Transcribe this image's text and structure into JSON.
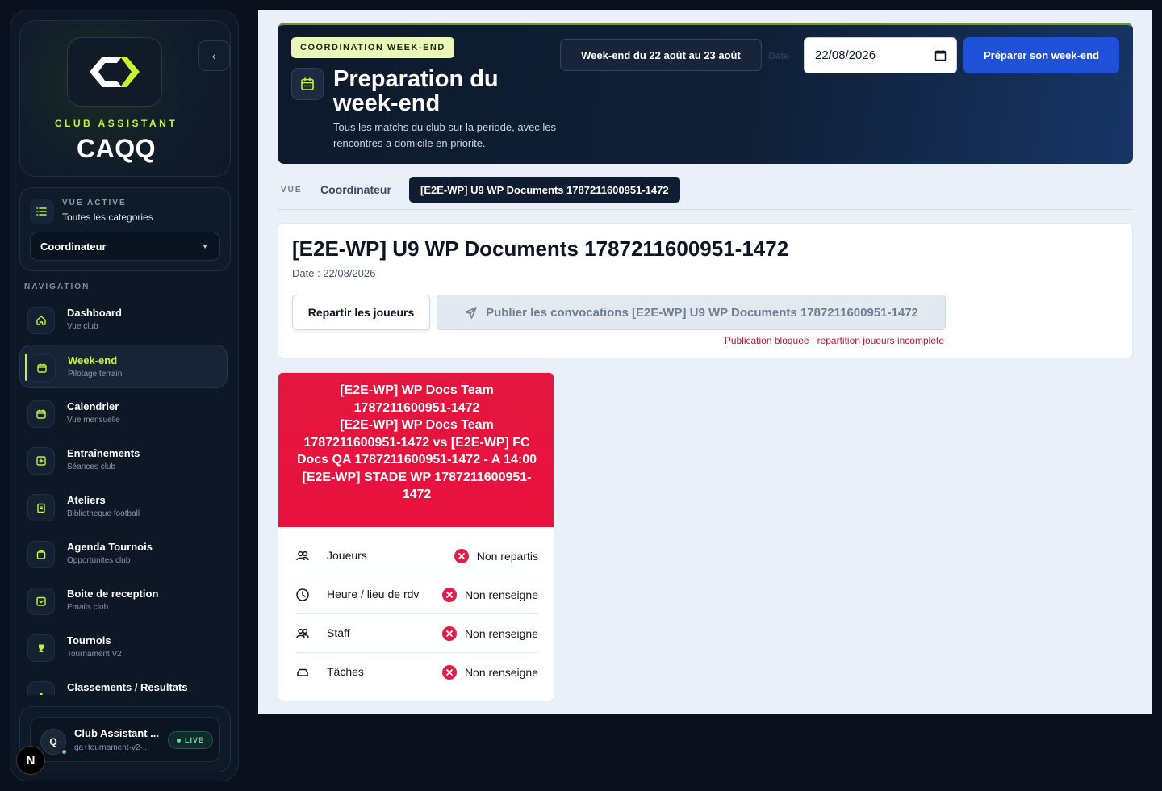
{
  "sidebar": {
    "brand_tag": "CLUB ASSISTANT",
    "brand_name": "CAQQ",
    "collapse_label": "‹",
    "view": {
      "kicker": "VUE ACTIVE",
      "value": "Toutes les categories",
      "selected": "Coordinateur"
    },
    "nav_title": "NAVIGATION",
    "items": [
      {
        "label": "Dashboard",
        "sub": "Vue club",
        "icon": "home-icon"
      },
      {
        "label": "Week-end",
        "sub": "Pilotage terrain",
        "icon": "calendar-icon"
      },
      {
        "label": "Calendrier",
        "sub": "Vue mensuelle",
        "icon": "calendar-icon"
      },
      {
        "label": "Entraînements",
        "sub": "Séances club",
        "icon": "plus-square-icon"
      },
      {
        "label": "Ateliers",
        "sub": "Bibliotheque football",
        "icon": "clipboard-icon"
      },
      {
        "label": "Agenda Tournois",
        "sub": "Opportunites club",
        "icon": "briefcase-icon"
      },
      {
        "label": "Boite de reception",
        "sub": "Emails club",
        "icon": "inbox-icon"
      },
      {
        "label": "Tournois",
        "sub": "Tournament V2",
        "icon": "trophy-icon"
      },
      {
        "label": "Classements / Resultats",
        "sub": "",
        "icon": "podium-icon"
      }
    ],
    "user": {
      "initial": "Q",
      "name": "Club Assistant ...",
      "email": "qa+tournament-v2-...",
      "badge": "LIVE"
    },
    "next_badge": "N"
  },
  "hero": {
    "kicker": "COORDINATION WEEK-END",
    "title": "Preparation du week-end",
    "description": "Tous les matchs du club sur la periode, avec les rencontres a domicile en priorite.",
    "weekend_range": "Week-end du 22 août au 23 août",
    "date_label": "Date",
    "date_value": "22/08/2026",
    "prepare_button": "Préparer son week-end"
  },
  "tabs": {
    "kicker": "VUE",
    "coordinator": "Coordinateur",
    "active": "[E2E-WP] U9 WP Documents 1787211600951-1472"
  },
  "team": {
    "title": "[E2E-WP] U9 WP Documents 1787211600951-1472",
    "date": "Date : 22/08/2026",
    "repartir_button": "Repartir les joueurs",
    "publish_button": "Publier les convocations [E2E-WP] U9 WP Documents 1787211600951-1472",
    "warning": "Publication bloquee : repartition joueurs incomplete"
  },
  "match": {
    "header_lines": [
      "[E2E-WP] WP Docs Team 1787211600951-1472",
      "[E2E-WP] WP Docs Team 1787211600951-1472 vs [E2E-WP] FC Docs QA 1787211600951-1472 - A 14:00",
      "[E2E-WP] STADE WP 1787211600951-1472"
    ],
    "rows": [
      {
        "label": "Joueurs",
        "status": "Non repartis",
        "icon": "users-icon"
      },
      {
        "label": "Heure / lieu de rdv",
        "status": "Non renseigne",
        "icon": "clock-icon"
      },
      {
        "label": "Staff",
        "status": "Non renseigne",
        "icon": "users-icon"
      },
      {
        "label": "Tâches",
        "status": "Non renseigne",
        "icon": "car-icon"
      }
    ]
  },
  "colors": {
    "accent": "#c6f432",
    "primary_button": "#1e50d8",
    "match_header": "#e8113d",
    "error": "#e01e4a"
  }
}
